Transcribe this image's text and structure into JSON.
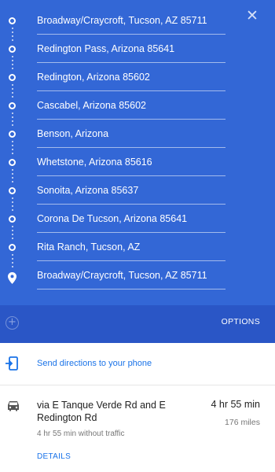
{
  "waypoints": [
    "Broadway/Craycroft, Tucson, AZ 85711",
    "Redington Pass, Arizona 85641",
    "Redington, Arizona 85602",
    "Cascabel, Arizona 85602",
    "Benson, Arizona",
    "Whetstone, Arizona 85616",
    "Sonoita, Arizona 85637",
    "Corona De Tucson, Arizona 85641",
    "Rita Ranch, Tucson, AZ",
    "Broadway/Craycroft, Tucson, AZ 85711"
  ],
  "close_label": "✕",
  "add_destination_label": "+",
  "options_label": "OPTIONS",
  "send_directions_label": "Send directions to your phone",
  "route": {
    "via": "via E Tanque Verde Rd and E Redington Rd",
    "duration": "4 hr 55 min",
    "distance": "176 miles",
    "traffic_note": "4 hr 55 min without traffic",
    "details_label": "DETAILS"
  },
  "colors": {
    "header": "#3367d6",
    "options_bar": "#2a56c6",
    "link": "#1a73e8"
  },
  "icons": {
    "waypoint": "hollow-circle",
    "destination": "map-pin-icon",
    "send": "phone-send-icon",
    "route": "car-icon"
  }
}
